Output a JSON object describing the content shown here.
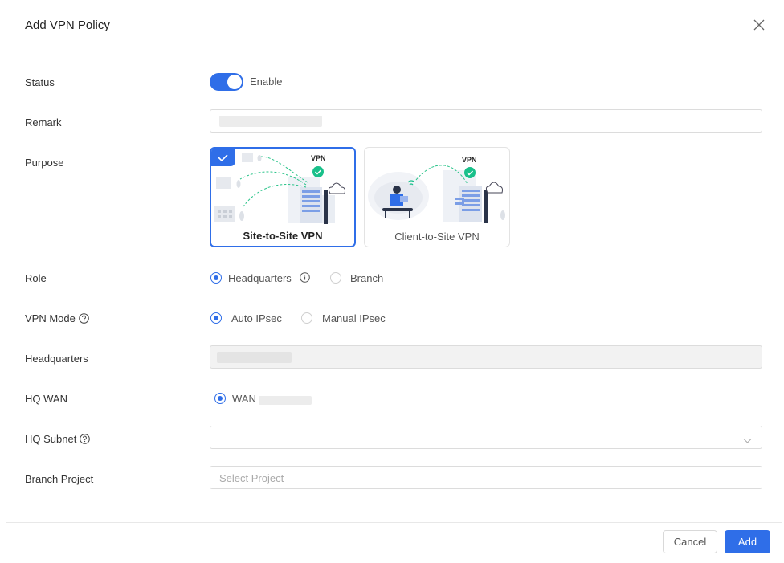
{
  "dialog": {
    "title": "Add VPN Policy",
    "close_icon": "close-icon"
  },
  "fields": {
    "status_label": "Status",
    "status_toggle_text": "Enable",
    "status_enabled": true,
    "remark_label": "Remark",
    "remark_value": "",
    "purpose_label": "Purpose",
    "purpose_options": [
      {
        "label": "Site-to-Site VPN",
        "badge": "VPN",
        "selected": true
      },
      {
        "label": "Client-to-Site VPN",
        "badge": "VPN",
        "selected": false
      }
    ],
    "role_label": "Role",
    "role_options": [
      {
        "label": "Headquarters",
        "selected": true
      },
      {
        "label": "Branch",
        "selected": false
      }
    ],
    "vpn_mode_label": "VPN Mode",
    "vpn_mode_options": [
      {
        "label": "Auto IPsec",
        "selected": true
      },
      {
        "label": "Manual IPsec",
        "selected": false
      }
    ],
    "headquarters_label": "Headquarters",
    "hq_wan_label": "HQ WAN",
    "hq_wan_option": "WAN",
    "hq_subnet_label": "HQ Subnet",
    "branch_project_label": "Branch Project",
    "branch_project_placeholder": "Select Project"
  },
  "footer": {
    "cancel_label": "Cancel",
    "add_label": "Add"
  },
  "colors": {
    "accent": "#2f6ee8",
    "success": "#19c08a"
  }
}
